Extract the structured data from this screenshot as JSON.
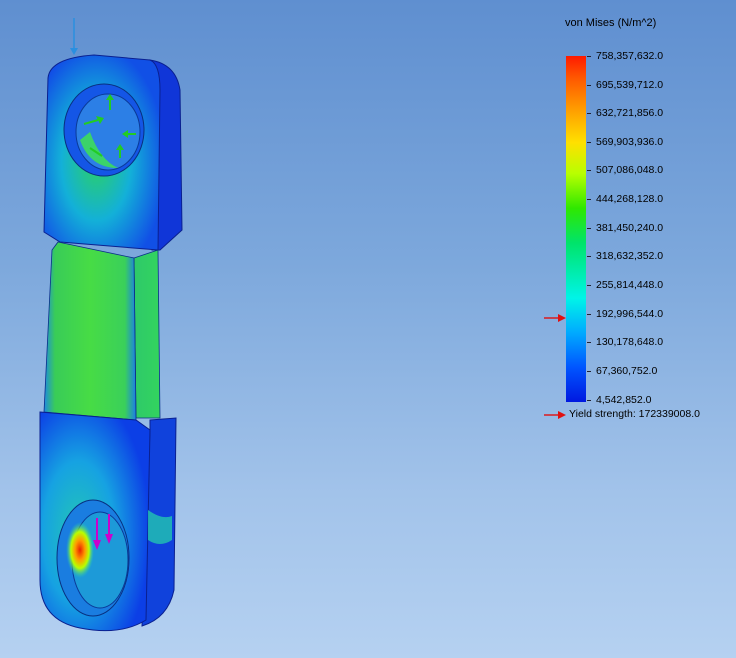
{
  "legend": {
    "title": "von Mises (N/m^2)",
    "values": [
      "758,357,632.0",
      "695,539,712.0",
      "632,721,856.0",
      "569,903,936.0",
      "507,086,048.0",
      "444,268,128.0",
      "381,450,240.0",
      "318,632,352.0",
      "255,814,448.0",
      "192,996,544.0",
      "130,178,648.0",
      "67,360,752.0",
      "4,542,852.0"
    ],
    "yield_label": "Yield strength: 172339008.0",
    "yield_value": 172339008.0,
    "max_value": 758357632.0,
    "min_value": 4542852.0
  },
  "colors": {
    "marker_arrow": "#e01010",
    "fixture_arrows": "#22cc22",
    "load_arrows": "#cc00cc"
  },
  "icons": {
    "triad": "coordinate-triad-icon",
    "yield_marker": "red-arrow-icon",
    "fixtures": "fixture-arrow-icon",
    "loads": "force-arrow-icon"
  }
}
